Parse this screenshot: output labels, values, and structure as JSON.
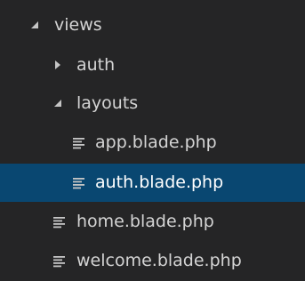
{
  "explorer": {
    "items": [
      {
        "label": "views",
        "type": "folder",
        "expanded": true,
        "depth": 0,
        "selected": false
      },
      {
        "label": "auth",
        "type": "folder",
        "expanded": false,
        "depth": 1,
        "selected": false
      },
      {
        "label": "layouts",
        "type": "folder",
        "expanded": true,
        "depth": 1,
        "selected": false
      },
      {
        "label": "app.blade.php",
        "type": "file",
        "depth": 2,
        "selected": false
      },
      {
        "label": "auth.blade.php",
        "type": "file",
        "depth": 2,
        "selected": true
      },
      {
        "label": "home.blade.php",
        "type": "file",
        "depth": 1,
        "selected": false
      },
      {
        "label": "welcome.blade.php",
        "type": "file",
        "depth": 1,
        "selected": false
      }
    ]
  },
  "colors": {
    "background": "#252526",
    "selection": "#094771",
    "text": "#d4d4d4",
    "selected_text": "#ffffff",
    "icon": "#c5c5c5"
  },
  "icons": {
    "expanded_folder": "chevron-down-icon",
    "collapsed_folder": "chevron-right-icon",
    "file": "file-lines-icon"
  }
}
